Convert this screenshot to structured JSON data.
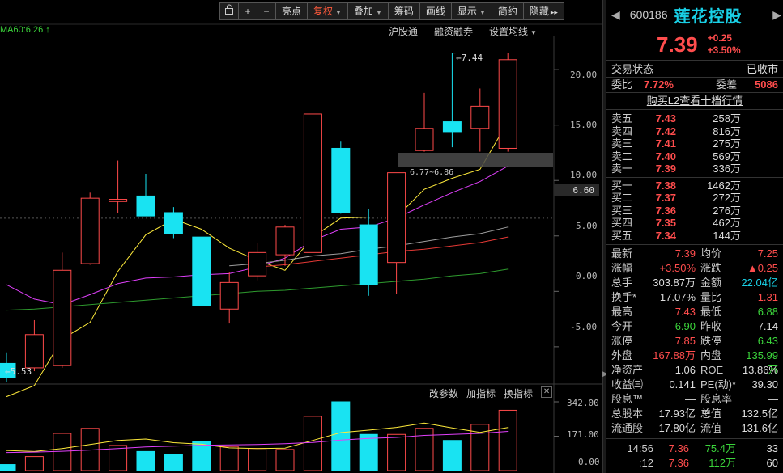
{
  "toolbar": {
    "items": [
      {
        "label": "亮点",
        "active": false,
        "dropdown": false
      },
      {
        "label": "复权",
        "active": true,
        "dropdown": true
      },
      {
        "label": "叠加",
        "active": false,
        "dropdown": true
      },
      {
        "label": "筹码",
        "active": false,
        "dropdown": false
      },
      {
        "label": "画线",
        "active": false,
        "dropdown": false
      },
      {
        "label": "显示",
        "active": false,
        "dropdown": true
      },
      {
        "label": "简约",
        "active": false,
        "dropdown": false
      },
      {
        "label": "隐藏",
        "active": false,
        "dropdown": false
      }
    ],
    "icons": [
      "lock-icon",
      "zoom-in-icon",
      "zoom-out-icon",
      "expand-right-icon"
    ],
    "zoom_in": "+",
    "zoom_out": "−",
    "expand": "▸▸"
  },
  "subbar": {
    "hgt": "沪股通",
    "margin": "融资融券",
    "ma_settings": "设置均线"
  },
  "ma_label": "MA60:6.26 ↑",
  "y_axis": {
    "ticks": [
      "20.00",
      "15.00",
      "10.00",
      "5.00",
      "0.00",
      "-5.00"
    ],
    "cursor_value": "6.60"
  },
  "chart_annotations": {
    "high": "←7.44",
    "low": "←5.53",
    "band": "6.77~6.86"
  },
  "indicator": {
    "change_params": "改参数",
    "add_indicator": "加指标",
    "switch_indicator": "换指标",
    "close": "✕",
    "y_ticks": [
      "342.00",
      "171.00",
      "0.00"
    ]
  },
  "chart_data": {
    "type": "candlestick",
    "title": "",
    "ylim": [
      -8,
      23
    ],
    "candles": [
      {
        "o": -6.5,
        "c": -7.8,
        "h": -5.5,
        "l": -8.2
      },
      {
        "o": -6.9,
        "c": -3.9,
        "h": -2.6,
        "l": -7.2
      },
      {
        "o": -6.7,
        "c": 1.9,
        "h": 3.5,
        "l": -6.9
      },
      {
        "o": 2.5,
        "c": 8.4,
        "h": 8.9,
        "l": 2.4
      },
      {
        "o": 8.1,
        "c": 8.3,
        "h": 11.8,
        "l": 7.1
      },
      {
        "o": 8.6,
        "c": 6.8,
        "h": 10.6,
        "l": 6.8
      },
      {
        "o": 7.1,
        "c": 5.2,
        "h": 7.6,
        "l": 4.8
      },
      {
        "o": 4.9,
        "c": -1.3,
        "h": 4.9,
        "l": -1.3
      },
      {
        "o": -1.6,
        "c": 0.8,
        "h": 1.7,
        "l": -2.9
      },
      {
        "o": 1.4,
        "c": 3.5,
        "h": 4.4,
        "l": 1.0
      },
      {
        "o": 3.3,
        "c": 5.8,
        "h": 6.0,
        "l": 2.3
      },
      {
        "o": 3.5,
        "c": 16.0,
        "h": 16.0,
        "l": 3.5
      },
      {
        "o": 12.9,
        "c": 7.1,
        "h": 13.5,
        "l": 7.0
      },
      {
        "o": 6.0,
        "c": 0.6,
        "h": 7.4,
        "l": -0.4
      },
      {
        "o": 2.6,
        "c": 10.7,
        "h": 10.7,
        "l": -0.2
      },
      {
        "o": 12.7,
        "c": 14.7,
        "h": 17.9,
        "l": 12.6
      },
      {
        "o": 15.3,
        "c": 14.4,
        "h": 21.5,
        "l": 13.0
      },
      {
        "o": 14.7,
        "c": 16.7,
        "h": 18.3,
        "l": 12.6
      },
      {
        "o": 12.9,
        "c": 20.9,
        "h": 21.5,
        "l": 12.6
      }
    ],
    "ma_lines": [
      {
        "name": "MA5",
        "color": "#ffeb3b",
        "values": [
          -9.5,
          -8.5,
          -4.3,
          -2.8,
          1.8,
          5.1,
          6.5,
          5.6,
          3.9,
          2.8,
          1.9,
          4.9,
          6.6,
          6.7,
          6.7,
          9.2,
          10.2,
          11.0,
          15.3
        ]
      },
      {
        "name": "MA10",
        "color": "#e040fb",
        "values": [
          0.6,
          -0.7,
          -1.2,
          -0.3,
          0.7,
          1.2,
          1.3,
          1.5,
          1.6,
          2.2,
          3.0,
          4.6,
          5.6,
          5.8,
          6.6,
          7.8,
          8.9,
          9.9,
          11.3
        ]
      },
      {
        "name": "MA20",
        "color": "#9e9e9e",
        "values": [
          null,
          null,
          null,
          null,
          null,
          null,
          null,
          null,
          2.3,
          2.5,
          2.8,
          3.2,
          3.4,
          3.8,
          4.1,
          4.5,
          4.9,
          5.2,
          5.8
        ]
      },
      {
        "name": "MA30",
        "color": "#e53935",
        "values": [
          null,
          null,
          null,
          null,
          null,
          null,
          null,
          null,
          null,
          2.2,
          2.4,
          2.7,
          3.0,
          3.3,
          3.6,
          3.8,
          4.1,
          4.4,
          4.9
        ]
      },
      {
        "name": "MA60",
        "color": "#2e9b2e",
        "values": [
          -1.7,
          -1.6,
          -1.4,
          -1.2,
          -1.0,
          -0.8,
          -0.6,
          -0.4,
          -0.2,
          -0.0,
          0.1,
          0.3,
          0.5,
          0.7,
          0.9,
          1.1,
          1.4,
          1.6,
          2.0
        ]
      }
    ],
    "volume": {
      "ylim": [
        0,
        342
      ],
      "values": [
        30,
        70,
        185,
        210,
        125,
        95,
        80,
        145,
        120,
        110,
        105,
        270,
        342,
        180,
        180,
        210,
        150,
        230,
        300
      ],
      "ma_lines": [
        {
          "color": "#ffeb3b",
          "values": [
            100,
            95,
            110,
            130,
            150,
            157,
            139,
            131,
            113,
            110,
            112,
            150,
            189,
            201,
            215,
            236,
            212,
            190,
            214
          ]
        },
        {
          "color": "#e040fb",
          "values": [
            90,
            92,
            96,
            102,
            110,
            118,
            122,
            126,
            128,
            130,
            134,
            140,
            152,
            160,
            165,
            175,
            180,
            185,
            195
          ]
        }
      ]
    }
  },
  "sidebar": {
    "code": "600186",
    "name": "莲花控股",
    "nav_prev": "◀",
    "nav_next": "▶",
    "price": "7.39",
    "change": "+0.25",
    "change_pct": "+3.50%",
    "trade_status_label": "交易状态",
    "trade_status": "已收市",
    "weibi_label": "委比",
    "weibi": "7.72%",
    "weicha_label": "委差",
    "weicha": "5086",
    "l2_link": "购买L2查看十档行情",
    "asks": [
      {
        "label": "卖五",
        "price": "7.43",
        "vol": "258万"
      },
      {
        "label": "卖四",
        "price": "7.42",
        "vol": "816万"
      },
      {
        "label": "卖三",
        "price": "7.41",
        "vol": "275万"
      },
      {
        "label": "卖二",
        "price": "7.40",
        "vol": "569万"
      },
      {
        "label": "卖一",
        "price": "7.39",
        "vol": "336万"
      }
    ],
    "bids": [
      {
        "label": "买一",
        "price": "7.38",
        "vol": "1462万"
      },
      {
        "label": "买二",
        "price": "7.37",
        "vol": "272万"
      },
      {
        "label": "买三",
        "price": "7.36",
        "vol": "276万"
      },
      {
        "label": "买四",
        "price": "7.35",
        "vol": "462万"
      },
      {
        "label": "买五",
        "price": "7.34",
        "vol": "144万"
      }
    ],
    "stats": [
      {
        "k": "最新",
        "v": "7.39",
        "vc": "red",
        "k2": "均价",
        "v2": "7.25",
        "v2c": "red"
      },
      {
        "k": "涨幅",
        "v": "+3.50%",
        "vc": "red",
        "k2": "涨跌",
        "v2": "▲0.25",
        "v2c": "red"
      },
      {
        "k": "总手",
        "v": "303.87万",
        "vc": "white",
        "k2": "金额",
        "v2": "22.04亿",
        "v2c": "cyan"
      },
      {
        "k": "换手*",
        "v": "17.07%",
        "vc": "white",
        "k2": "量比",
        "v2": "1.31",
        "v2c": "red"
      },
      {
        "k": "最高",
        "v": "7.43",
        "vc": "red",
        "k2": "最低",
        "v2": "6.88",
        "v2c": "green"
      },
      {
        "k": "今开",
        "v": "6.90",
        "vc": "green",
        "k2": "昨收",
        "v2": "7.14",
        "v2c": "white"
      },
      {
        "k": "涨停",
        "v": "7.85",
        "vc": "red",
        "k2": "跌停",
        "v2": "6.43",
        "v2c": "green"
      },
      {
        "k": "外盘",
        "v": "167.88万",
        "vc": "red",
        "k2": "内盘",
        "v2": "135.99万",
        "v2c": "green"
      },
      {
        "k": "净资产",
        "v": "1.06",
        "vc": "white",
        "k2": "ROE",
        "v2": "13.86%",
        "v2c": "white"
      },
      {
        "k": "收益㈢",
        "v": "0.141",
        "vc": "white",
        "k2": "PE(动)*",
        "v2": "39.30",
        "v2c": "white"
      },
      {
        "k": "股息™",
        "v": "—",
        "vc": "white",
        "k2": "股息率™",
        "v2": "—",
        "v2c": "white"
      },
      {
        "k": "总股本",
        "v": "17.93亿",
        "vc": "white",
        "k2": "总值",
        "v2": "132.5亿",
        "v2c": "white"
      },
      {
        "k": "流通股",
        "v": "17.80亿",
        "vc": "white",
        "k2": "流值",
        "v2": "131.6亿",
        "v2c": "white"
      }
    ],
    "ticks": [
      {
        "time": "14:56",
        "price": "7.36",
        "vol": "75.4万",
        "n": "33"
      },
      {
        "time": ":12",
        "price": "7.36",
        "vol": "112万",
        "n": "60"
      }
    ]
  }
}
